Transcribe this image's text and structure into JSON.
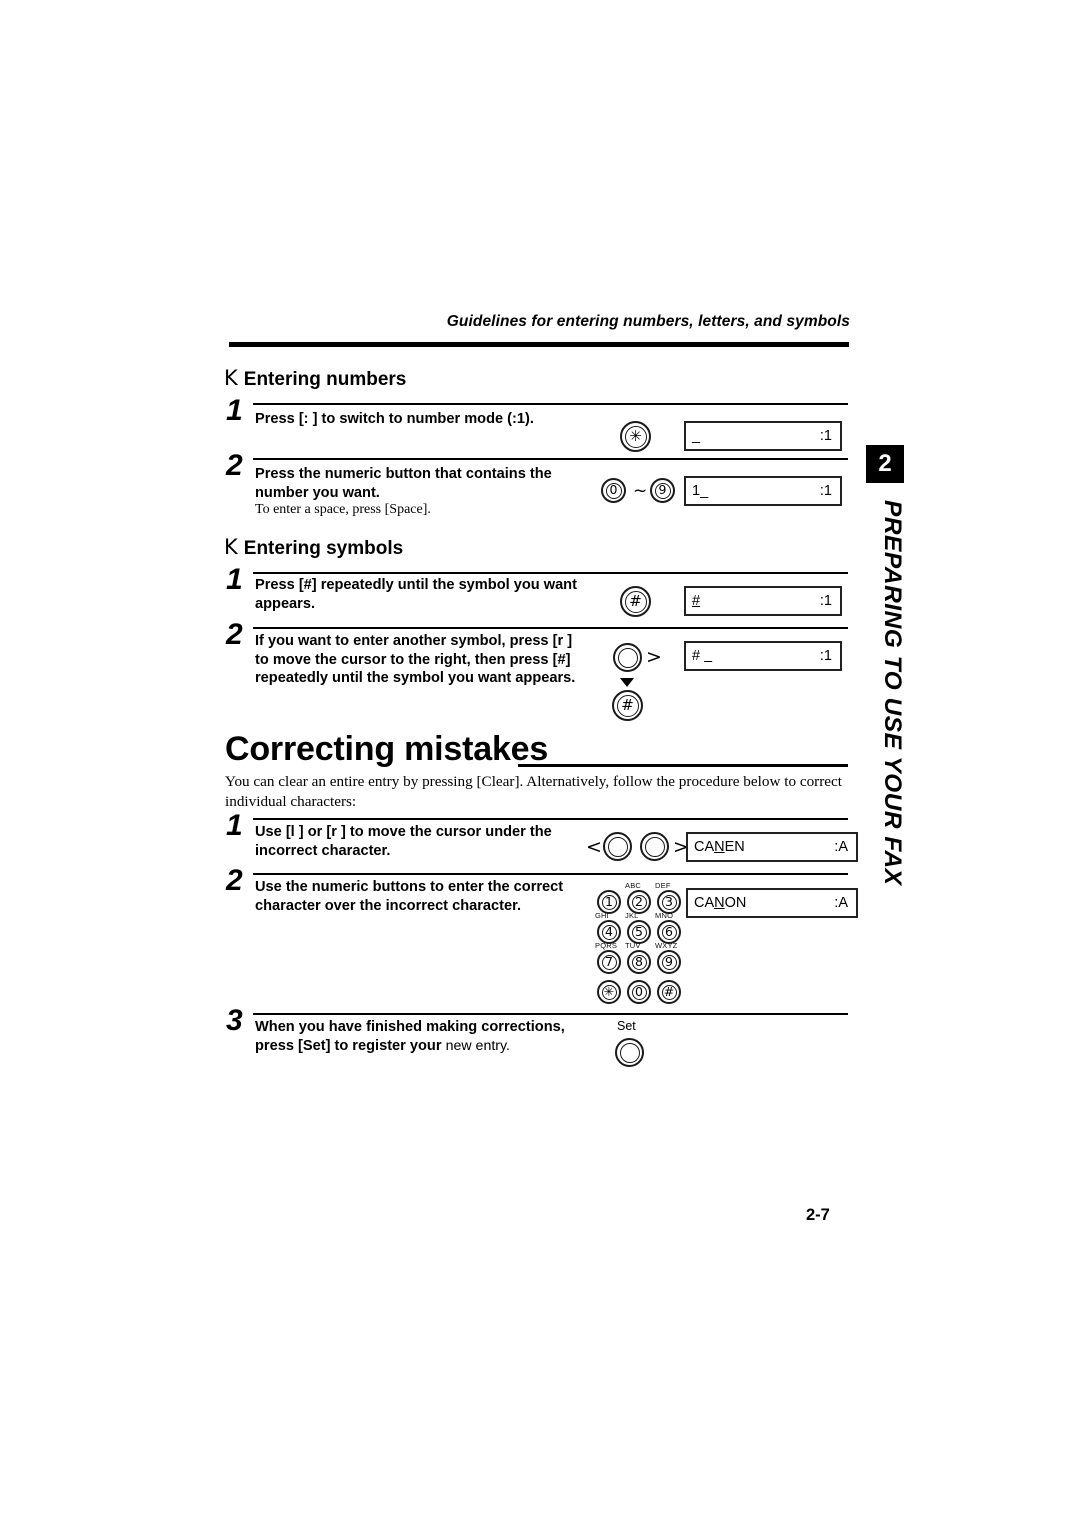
{
  "header": {
    "running_title": "Guidelines for entering numbers, letters, and symbols"
  },
  "chapter_tab": {
    "number": "2",
    "label": "PREPARING TO USE YOUR FAX"
  },
  "folio": "2-7",
  "sections": [
    {
      "id": "entering-numbers",
      "bullet": "K",
      "title": "Entering numbers",
      "steps": [
        {
          "number": "1",
          "text": "Press [:  ] to switch to number mode (:1).",
          "note": "",
          "keys": [
            {
              "name": "asterisk-key",
              "glyph": "✳"
            }
          ],
          "lcd": {
            "left": "_",
            "right": ":1"
          }
        },
        {
          "number": "2",
          "text": "Press the numeric button that contains the number you want.",
          "note": "To enter a space, press [Space].",
          "keys": [
            {
              "name": "zero-key",
              "glyph": "0"
            },
            {
              "name": "range-tilde",
              "glyph": "~"
            },
            {
              "name": "nine-key",
              "glyph": "9"
            }
          ],
          "lcd": {
            "left": "1_",
            "right": ":1"
          }
        }
      ]
    },
    {
      "id": "entering-symbols",
      "bullet": "K",
      "title": "Entering symbols",
      "steps": [
        {
          "number": "1",
          "text": "Press [#] repeatedly until the symbol you want appears.",
          "note": "",
          "keys": [
            {
              "name": "hash-key",
              "glyph": "#"
            }
          ],
          "lcd": {
            "left": "#",
            "right": ":1"
          }
        },
        {
          "number": "2",
          "text": "If you want to enter another symbol, press [r   ] to move the cursor to the right, then press [#] repeatedly until the symbol you want appears.",
          "note": "",
          "keys": [
            {
              "name": "right-cursor-key",
              "glyph": ""
            },
            {
              "name": "right-angle",
              "glyph": ">"
            },
            {
              "name": "hash-key",
              "glyph": "#"
            }
          ],
          "lcd": {
            "left": "# ",
            "right": ":1"
          }
        }
      ]
    }
  ],
  "correcting": {
    "title": "Correcting mistakes",
    "intro": "You can clear an entire entry by pressing [Clear]. Alternatively, follow the procedure below to correct individual characters:",
    "steps": [
      {
        "number": "1",
        "text": "Use [l   ] or [r   ] to move the cursor under the incorrect character.",
        "left_angle": "<",
        "right_angle": ">",
        "lcd": {
          "left_before": "CA",
          "left_cursor": "N",
          "left_after": "EN",
          "right": ":A"
        }
      },
      {
        "number": "2",
        "text": "Use the numeric buttons to enter the correct character over the incorrect character.",
        "lcd": {
          "left_before": "CA",
          "left_cursor": "N",
          "left_after": "ON",
          "right": ":A"
        }
      },
      {
        "number": "3",
        "text_bold": "When you have finished making corrections, press [Set] to register your ",
        "text_light": "new entry.",
        "set_label": "Set"
      }
    ]
  },
  "keypad": {
    "keys": [
      {
        "digit": "1",
        "letters": ""
      },
      {
        "digit": "2",
        "letters": "ABC"
      },
      {
        "digit": "3",
        "letters": "DEF"
      },
      {
        "digit": "4",
        "letters": "GHI"
      },
      {
        "digit": "5",
        "letters": "JKL"
      },
      {
        "digit": "6",
        "letters": "MNO"
      },
      {
        "digit": "7",
        "letters": "PQRS"
      },
      {
        "digit": "8",
        "letters": "TUV"
      },
      {
        "digit": "9",
        "letters": "WXYZ"
      },
      {
        "digit": "✳",
        "letters": ""
      },
      {
        "digit": "0",
        "letters": ""
      },
      {
        "digit": "#",
        "letters": ""
      }
    ]
  }
}
